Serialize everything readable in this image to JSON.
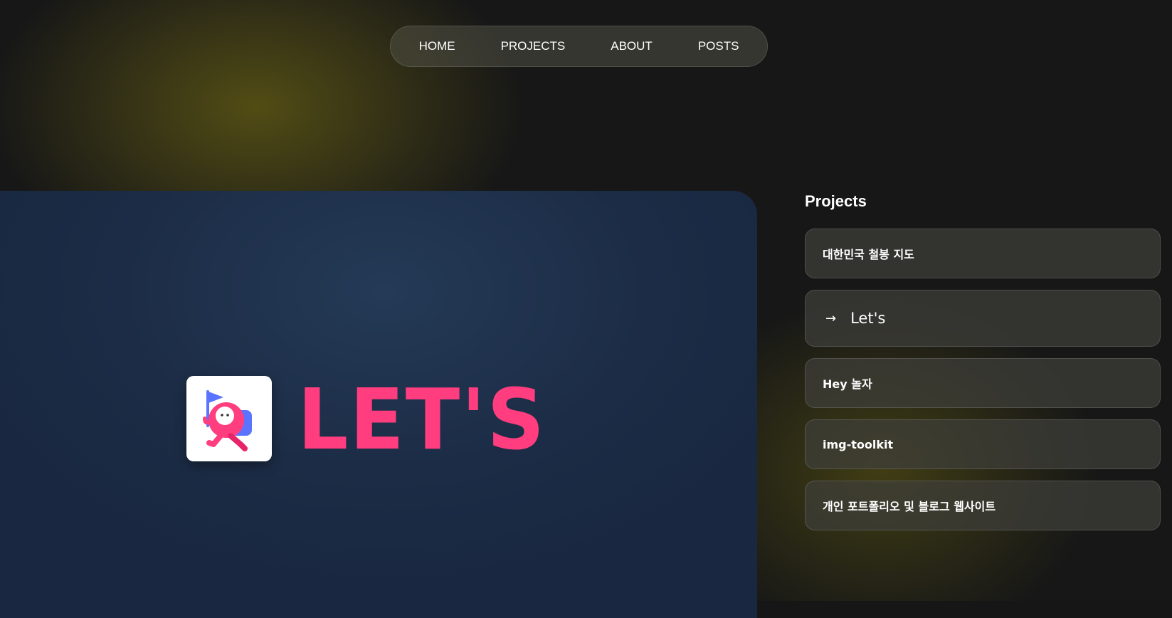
{
  "nav": {
    "items": [
      "HOME",
      "PROJECTS",
      "ABOUT",
      "POSTS"
    ]
  },
  "hero": {
    "logo_icon": "letsgo-mascot-icon",
    "logo_text": "LET'S",
    "colors": {
      "brand_pink": "#ff3d7f",
      "brand_blue": "#4d6bff"
    }
  },
  "sidebar": {
    "title": "Projects",
    "items": [
      {
        "label": "대한민국 철봉 지도",
        "active": false
      },
      {
        "label": "Let's",
        "active": true,
        "icon": "arrow-right-icon"
      },
      {
        "label": "Hey 놀자",
        "active": false
      },
      {
        "label": "img-toolkit",
        "active": false
      },
      {
        "label": "개인 포트폴리오 및 블로그 웹사이트",
        "active": false
      }
    ]
  }
}
